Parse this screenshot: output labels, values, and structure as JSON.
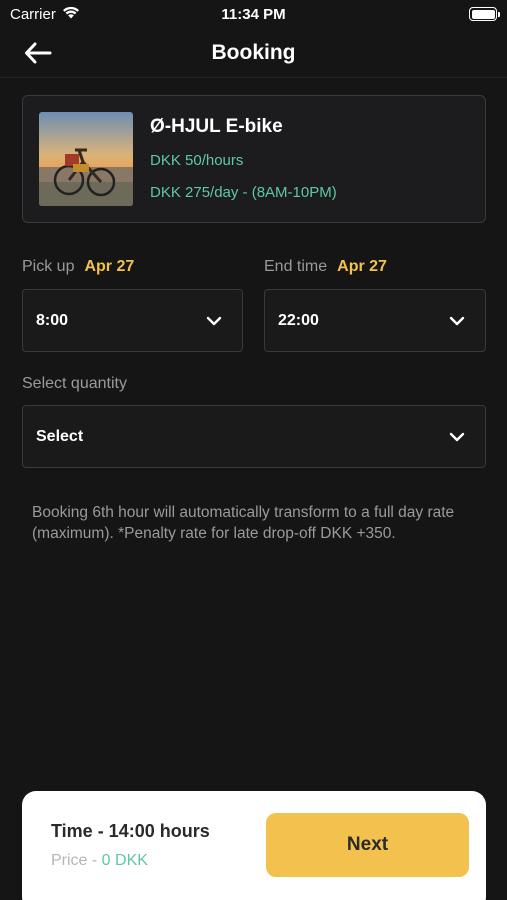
{
  "status_bar": {
    "carrier": "Carrier",
    "time": "11:34 PM"
  },
  "nav": {
    "title": "Booking"
  },
  "product": {
    "name": "Ø-HJUL E-bike",
    "hourly_rate": "DKK 50/hours",
    "daily_rate": "DKK 275/day - (8AM-10PM)"
  },
  "pickup": {
    "label": "Pick up",
    "date": "Apr 27",
    "time": "8:00"
  },
  "endtime": {
    "label": "End time",
    "date": "Apr 27",
    "time": "22:00"
  },
  "quantity": {
    "label": "Select quantity",
    "value": "Select"
  },
  "note": "Booking 6th hour will automatically transform to a full day rate (maximum). *Penalty rate for late drop-off DKK +350.",
  "summary": {
    "time": "Time - 14:00 hours",
    "price_label": "Price - ",
    "price_value": "0 DKK"
  },
  "next_button": {
    "label": "Next"
  },
  "colors": {
    "accent": "#f2c14e",
    "price_green": "#5ec9a0",
    "background": "#151515"
  }
}
